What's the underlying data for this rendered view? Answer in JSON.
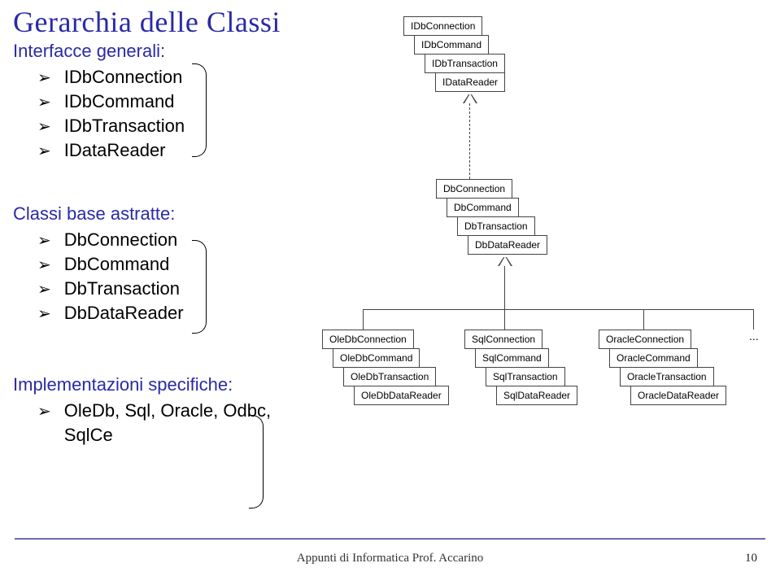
{
  "title": "Gerarchia delle Classi",
  "section1": {
    "heading": "Interfacce generali:",
    "items": [
      "IDbConnection",
      "IDbCommand",
      "IDbTransaction",
      "IDataReader"
    ]
  },
  "section2": {
    "heading": "Classi base astratte:",
    "items": [
      "DbConnection",
      "DbCommand",
      "DbTransaction",
      "DbDataReader"
    ]
  },
  "section3": {
    "heading": "Implementazioni specifiche:",
    "items": [
      "OleDb, Sql, Oracle, Odbc, SqlCe"
    ]
  },
  "diagram": {
    "interfaces": [
      "IDbConnection",
      "IDbCommand",
      "IDbTransaction",
      "IDataReader"
    ],
    "abstracts": [
      "DbConnection",
      "DbCommand",
      "DbTransaction",
      "DbDataReader"
    ],
    "impl_oledb": [
      "OleDbConnection",
      "OleDbCommand",
      "OleDbTransaction",
      "OleDbDataReader"
    ],
    "impl_sql": [
      "SqlConnection",
      "SqlCommand",
      "SqlTransaction",
      "SqlDataReader"
    ],
    "impl_oracle": [
      "OracleConnection",
      "OracleCommand",
      "OracleTransaction",
      "OracleDataReader"
    ],
    "ellipsis": "..."
  },
  "footer": "Appunti di Informatica Prof. Accarino",
  "pageNumber": "10"
}
